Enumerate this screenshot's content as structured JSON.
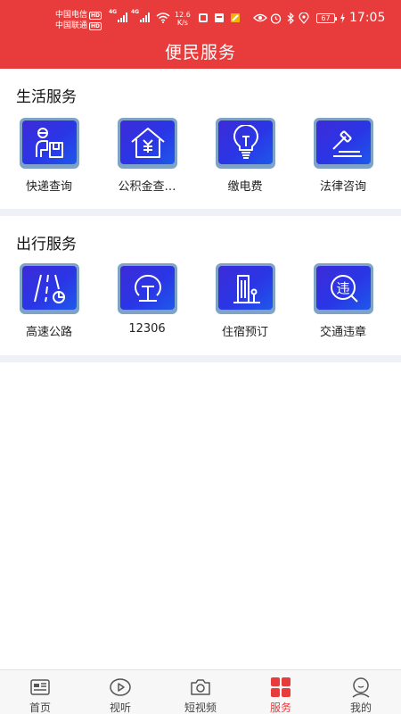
{
  "status_bar": {
    "carrier_1": "中国电信",
    "carrier_2": "中国联通",
    "hd_badge": "HD",
    "network_gen_1": "4G",
    "network_gen_2": "4G",
    "net_speed_value": "12.6",
    "net_speed_unit": "K/s",
    "battery_level": "67",
    "time": "17:05"
  },
  "header": {
    "title": "便民服务"
  },
  "life_section": {
    "title": "生活服务",
    "items": [
      {
        "label": "快递查询",
        "icon": "courier-icon"
      },
      {
        "label": "公积金查…",
        "icon": "housing-fund-icon"
      },
      {
        "label": "缴电费",
        "icon": "lightbulb-icon"
      },
      {
        "label": "法律咨询",
        "icon": "gavel-icon"
      }
    ]
  },
  "travel_section": {
    "title": "出行服务",
    "items": [
      {
        "label": "高速公路",
        "icon": "highway-icon"
      },
      {
        "label": "12306",
        "icon": "railway-icon"
      },
      {
        "label": "住宿预订",
        "icon": "hotel-icon"
      },
      {
        "label": "交通违章",
        "icon": "traffic-violation-icon"
      }
    ]
  },
  "tab_bar": {
    "active_color": "#e83b3b",
    "tabs": [
      {
        "label": "首页",
        "icon": "home-icon"
      },
      {
        "label": "视听",
        "icon": "play-icon"
      },
      {
        "label": "短视频",
        "icon": "camera-icon"
      },
      {
        "label": "服务",
        "icon": "grid-icon",
        "active": true
      },
      {
        "label": "我的",
        "icon": "profile-icon"
      }
    ]
  },
  "colors": {
    "brand_red": "#e83b3b",
    "tile_blue": "#2a36e6",
    "divider_gray": "#eef1f5"
  }
}
